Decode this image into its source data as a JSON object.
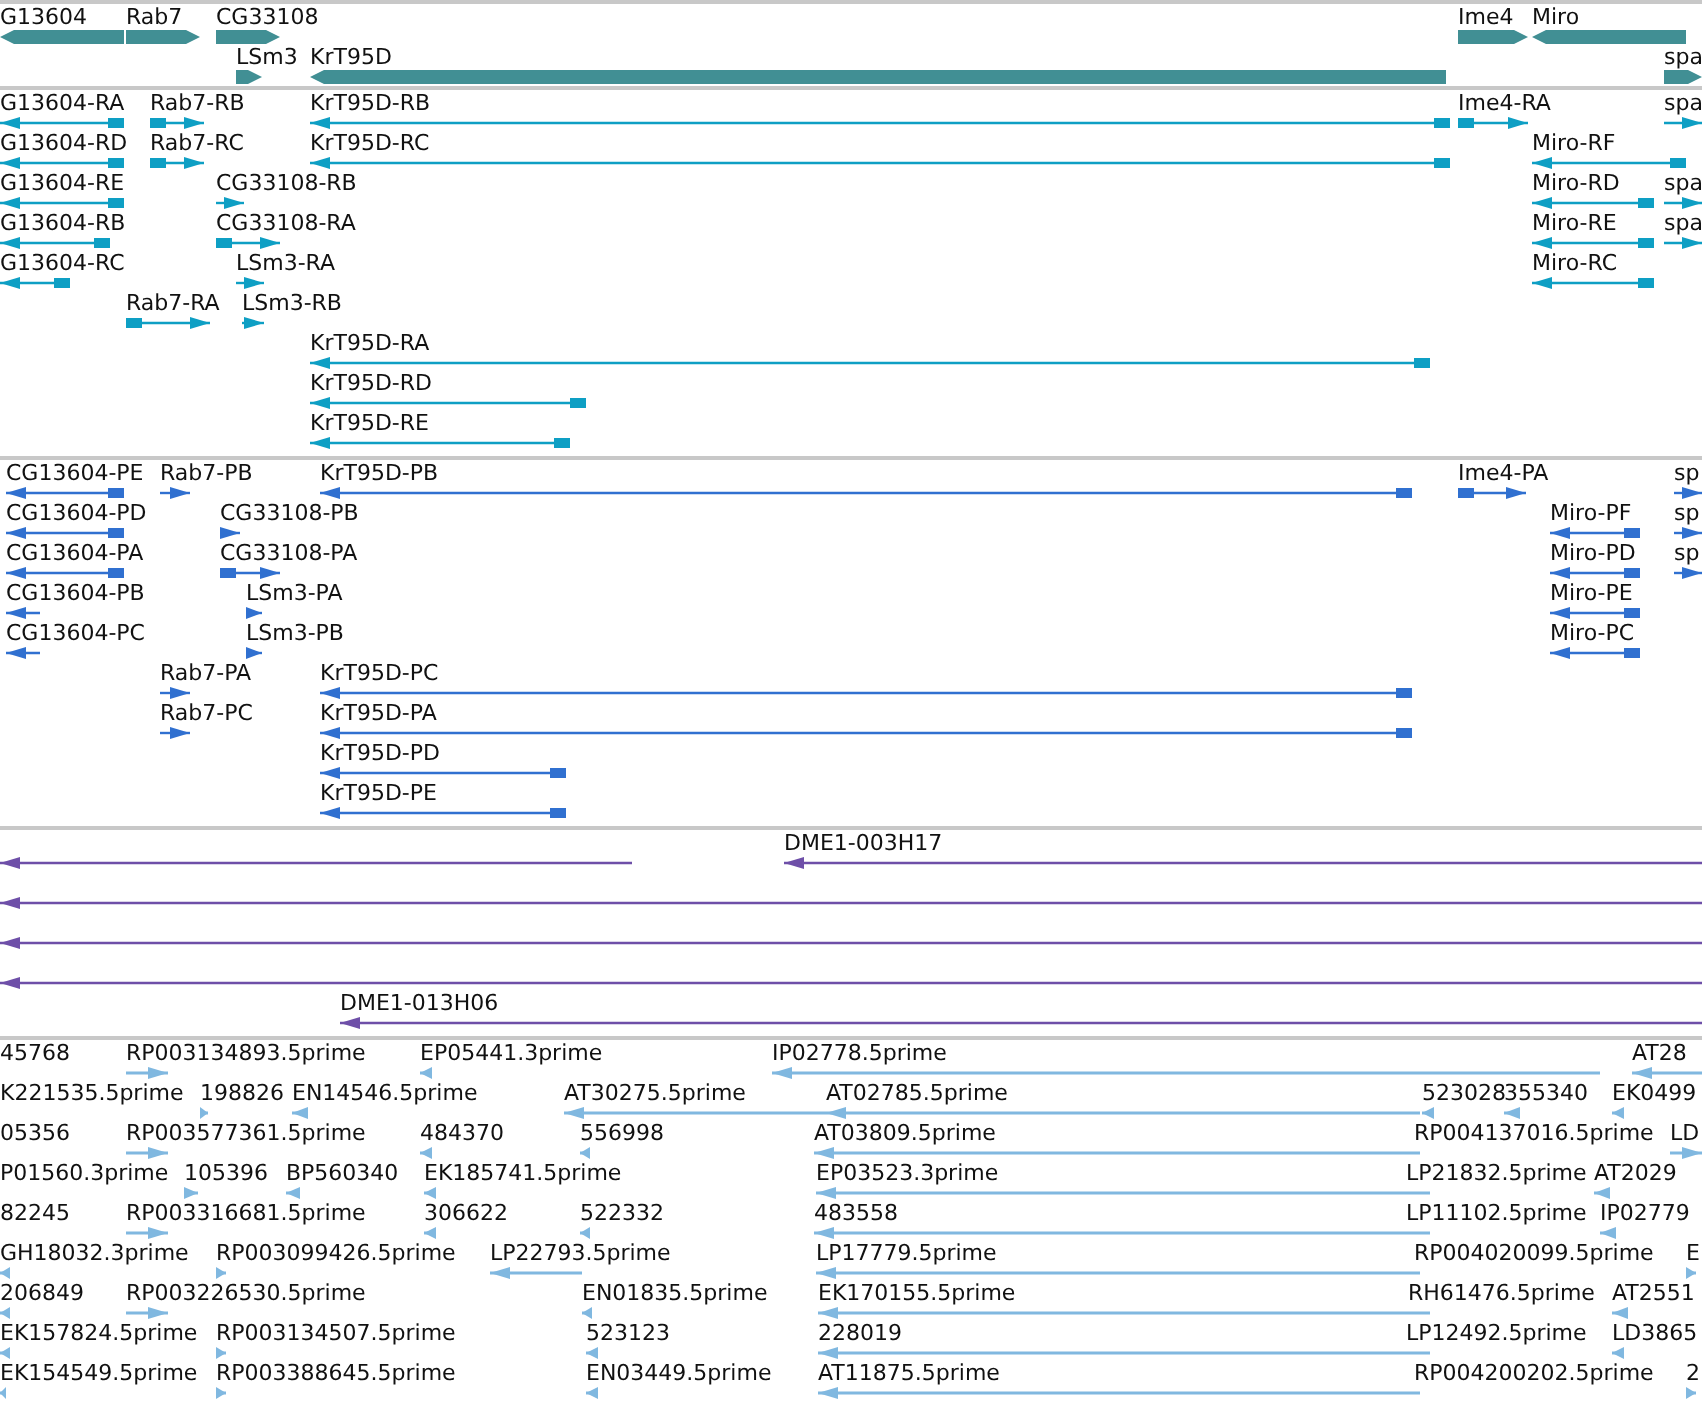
{
  "tracks": [
    {
      "kind": "gene",
      "features": [
        {
          "label": "G13604",
          "reverse": true
        },
        {
          "label": "Rab7",
          "reverse": false
        },
        {
          "label": "CG33108",
          "reverse": false
        },
        {
          "label": "LSm3",
          "reverse": false
        },
        {
          "label": "KrT95D",
          "reverse": true
        },
        {
          "label": "Ime4",
          "reverse": false
        },
        {
          "label": "Miro",
          "reverse": true
        },
        {
          "label": "spa",
          "reverse": false
        }
      ]
    },
    {
      "kind": "mrna",
      "features": [
        {
          "label": "G13604-RA",
          "reverse": true
        },
        {
          "label": "Rab7-RB",
          "reverse": false
        },
        {
          "label": "KrT95D-RB",
          "reverse": true
        },
        {
          "label": "Ime4-RA",
          "reverse": false
        },
        {
          "label": "spa",
          "reverse": false
        },
        {
          "label": "G13604-RD",
          "reverse": true
        },
        {
          "label": "Rab7-RC",
          "reverse": false
        },
        {
          "label": "KrT95D-RC",
          "reverse": true
        },
        {
          "label": "Miro-RF",
          "reverse": true
        },
        {
          "label": "G13604-RE",
          "reverse": true
        },
        {
          "label": "CG33108-RB",
          "reverse": false
        },
        {
          "label": "Miro-RD",
          "reverse": true
        },
        {
          "label": "spa",
          "reverse": false
        },
        {
          "label": "G13604-RB",
          "reverse": true
        },
        {
          "label": "CG33108-RA",
          "reverse": false
        },
        {
          "label": "Miro-RE",
          "reverse": true
        },
        {
          "label": "spa",
          "reverse": false
        },
        {
          "label": "G13604-RC",
          "reverse": true
        },
        {
          "label": "LSm3-RA",
          "reverse": false
        },
        {
          "label": "Miro-RC",
          "reverse": true
        },
        {
          "label": "Rab7-RA",
          "reverse": false
        },
        {
          "label": "LSm3-RB",
          "reverse": false
        },
        {
          "label": "KrT95D-RA",
          "reverse": true
        },
        {
          "label": "KrT95D-RD",
          "reverse": true
        },
        {
          "label": "KrT95D-RE",
          "reverse": true
        }
      ]
    },
    {
      "kind": "protein",
      "features": [
        {
          "label": "CG13604-PE",
          "reverse": true
        },
        {
          "label": "Rab7-PB",
          "reverse": false
        },
        {
          "label": "KrT95D-PB",
          "reverse": true
        },
        {
          "label": "Ime4-PA",
          "reverse": false
        },
        {
          "label": "sp",
          "reverse": false
        },
        {
          "label": "CG13604-PD",
          "reverse": true
        },
        {
          "label": "CG33108-PB",
          "reverse": false
        },
        {
          "label": "Miro-PF",
          "reverse": true
        },
        {
          "label": "sp",
          "reverse": false
        },
        {
          "label": "CG13604-PA",
          "reverse": true
        },
        {
          "label": "CG33108-PA",
          "reverse": false
        },
        {
          "label": "Miro-PD",
          "reverse": true
        },
        {
          "label": "sp",
          "reverse": false
        },
        {
          "label": "CG13604-PB",
          "reverse": true
        },
        {
          "label": "LSm3-PA",
          "reverse": false
        },
        {
          "label": "Miro-PE",
          "reverse": true
        },
        {
          "label": "CG13604-PC",
          "reverse": true
        },
        {
          "label": "LSm3-PB",
          "reverse": false
        },
        {
          "label": "Miro-PC",
          "reverse": true
        },
        {
          "label": "Rab7-PA",
          "reverse": false
        },
        {
          "label": "KrT95D-PC",
          "reverse": true
        },
        {
          "label": "Rab7-PC",
          "reverse": false
        },
        {
          "label": "KrT95D-PA",
          "reverse": true
        },
        {
          "label": "KrT95D-PD",
          "reverse": true
        },
        {
          "label": "KrT95D-PE",
          "reverse": true
        }
      ]
    },
    {
      "kind": "bac",
      "features": [
        {
          "reverse": true
        },
        {
          "label": "DME1-003H17",
          "reverse": true
        },
        {
          "reverse": true
        },
        {
          "reverse": true
        },
        {
          "reverse": true
        },
        {
          "label": "DME1-013H06",
          "reverse": true
        }
      ]
    },
    {
      "kind": "est",
      "features": [
        {
          "label": "45768"
        },
        {
          "label": "RP003134893.5prime",
          "reverse": false
        },
        {
          "label": "EP05441.3prime",
          "reverse": true
        },
        {
          "label": "IP02778.5prime",
          "reverse": true
        },
        {
          "label": "AT28",
          "reverse": true
        },
        {
          "label": "K221535.5prime"
        },
        {
          "label": "198826",
          "reverse": false
        },
        {
          "label": "EN14546.5prime",
          "reverse": true
        },
        {
          "label": "AT30275.5prime",
          "reverse": true
        },
        {
          "label": "AT02785.5prime",
          "reverse": true
        },
        {
          "label": "523028",
          "reverse": true
        },
        {
          "label": "355340",
          "reverse": true
        },
        {
          "label": "EK0499",
          "reverse": true
        },
        {
          "label": "05356"
        },
        {
          "label": "RP003577361.5prime",
          "reverse": false
        },
        {
          "label": "484370",
          "reverse": true
        },
        {
          "label": "556998",
          "reverse": true
        },
        {
          "label": "AT03809.5prime",
          "reverse": true
        },
        {
          "label": "RP004137016.5prime"
        },
        {
          "label": "LD",
          "reverse": false
        },
        {
          "label": "P01560.3prime"
        },
        {
          "label": "105396",
          "reverse": false
        },
        {
          "label": "BP560340",
          "reverse": true
        },
        {
          "label": "EK185741.5prime",
          "reverse": true
        },
        {
          "label": "EP03523.3prime",
          "reverse": true
        },
        {
          "label": "LP21832.5prime"
        },
        {
          "label": "AT2029",
          "reverse": true
        },
        {
          "label": "82245"
        },
        {
          "label": "RP003316681.5prime",
          "reverse": false
        },
        {
          "label": "306622",
          "reverse": true
        },
        {
          "label": "522332",
          "reverse": true
        },
        {
          "label": "483558",
          "reverse": true
        },
        {
          "label": "LP11102.5prime"
        },
        {
          "label": "IP02779",
          "reverse": true
        },
        {
          "label": "GH18032.3prime",
          "reverse": true
        },
        {
          "label": "RP003099426.5prime",
          "reverse": false
        },
        {
          "label": "LP22793.5prime",
          "reverse": true
        },
        {
          "label": "LP17779.5prime",
          "reverse": true
        },
        {
          "label": "RP004020099.5prime"
        },
        {
          "label": "E",
          "reverse": false
        },
        {
          "label": "206849",
          "reverse": true
        },
        {
          "label": "RP003226530.5prime",
          "reverse": false
        },
        {
          "label": "EN01835.5prime",
          "reverse": true
        },
        {
          "label": "EK170155.5prime",
          "reverse": true
        },
        {
          "label": "RH61476.5prime"
        },
        {
          "label": "AT2551",
          "reverse": true
        },
        {
          "label": "EK157824.5prime",
          "reverse": true
        },
        {
          "label": "RP003134507.5prime",
          "reverse": false
        },
        {
          "label": "523123",
          "reverse": true
        },
        {
          "label": "228019",
          "reverse": true
        },
        {
          "label": "LP12492.5prime"
        },
        {
          "label": "LD3865",
          "reverse": true
        },
        {
          "label": "EK154549.5prime",
          "reverse": true
        },
        {
          "label": "RP003388645.5prime",
          "reverse": false
        },
        {
          "label": "EN03449.5prime",
          "reverse": true
        },
        {
          "label": "AT11875.5prime",
          "reverse": true
        },
        {
          "label": "RP004200202.5prime"
        },
        {
          "label": "2",
          "reverse": false
        }
      ]
    }
  ]
}
